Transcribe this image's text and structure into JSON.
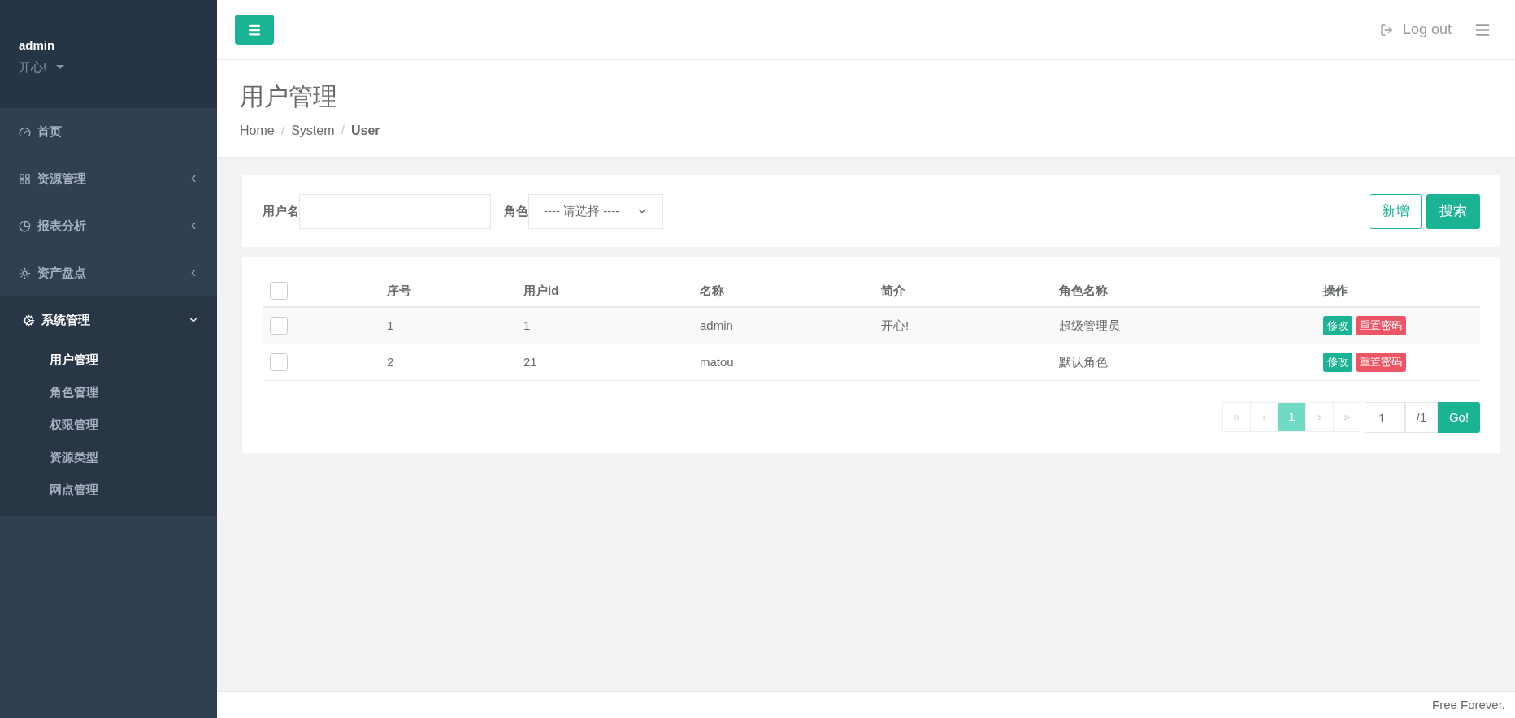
{
  "profile": {
    "name": "admin",
    "motto": "开心!"
  },
  "sidebar": {
    "items": [
      {
        "label": "首页",
        "has_children": false,
        "selected": false
      },
      {
        "label": "资源管理",
        "has_children": true,
        "expanded": false,
        "selected": false
      },
      {
        "label": "报表分析",
        "has_children": true,
        "expanded": false,
        "selected": false
      },
      {
        "label": "资产盘点",
        "has_children": true,
        "expanded": false,
        "selected": false
      },
      {
        "label": "系统管理",
        "has_children": true,
        "expanded": true,
        "selected": true,
        "children": [
          {
            "label": "用户管理",
            "selected": true
          },
          {
            "label": "角色管理",
            "selected": false
          },
          {
            "label": "权限管理",
            "selected": false
          },
          {
            "label": "资源类型",
            "selected": false
          },
          {
            "label": "网点管理",
            "selected": false
          }
        ]
      }
    ]
  },
  "header": {
    "logout": "Log out"
  },
  "page": {
    "title": "用户管理",
    "breadcrumb": [
      {
        "label": "Home",
        "current": false
      },
      {
        "label": "System",
        "current": false
      },
      {
        "label": "User",
        "current": true
      }
    ],
    "separator": "/"
  },
  "filter": {
    "username_label": "用户名",
    "role_label": "角色",
    "role_value": "---- 请选择 ----",
    "add": "新增",
    "search": "搜索"
  },
  "table": {
    "columns": [
      "序号",
      "用户id",
      "名称",
      "简介",
      "角色名称",
      "操作"
    ],
    "header_checked": false,
    "rows": [
      {
        "checked": false,
        "cells": [
          "1",
          "1",
          "admin",
          "开心!",
          "超级管理员"
        ],
        "actions": [
          {
            "label": "修改",
            "kind": "edit"
          },
          {
            "label": "重置密码",
            "kind": "reset"
          }
        ]
      },
      {
        "checked": false,
        "cells": [
          "2",
          "21",
          "matou",
          "",
          "默认角色"
        ],
        "actions": [
          {
            "label": "修改",
            "kind": "edit"
          },
          {
            "label": "重置密码",
            "kind": "reset"
          }
        ]
      }
    ]
  },
  "pagination": {
    "pages": [
      {
        "label": "«",
        "disabled": true,
        "selected": false
      },
      {
        "label": "‹",
        "disabled": true,
        "selected": false
      },
      {
        "label": "1",
        "disabled": false,
        "selected": true
      },
      {
        "label": "›",
        "disabled": true,
        "selected": false
      },
      {
        "label": "»",
        "disabled": true,
        "selected": false
      }
    ],
    "jump_value": "1",
    "total": "/1",
    "go": "Go!"
  },
  "footer": "Free Forever."
}
